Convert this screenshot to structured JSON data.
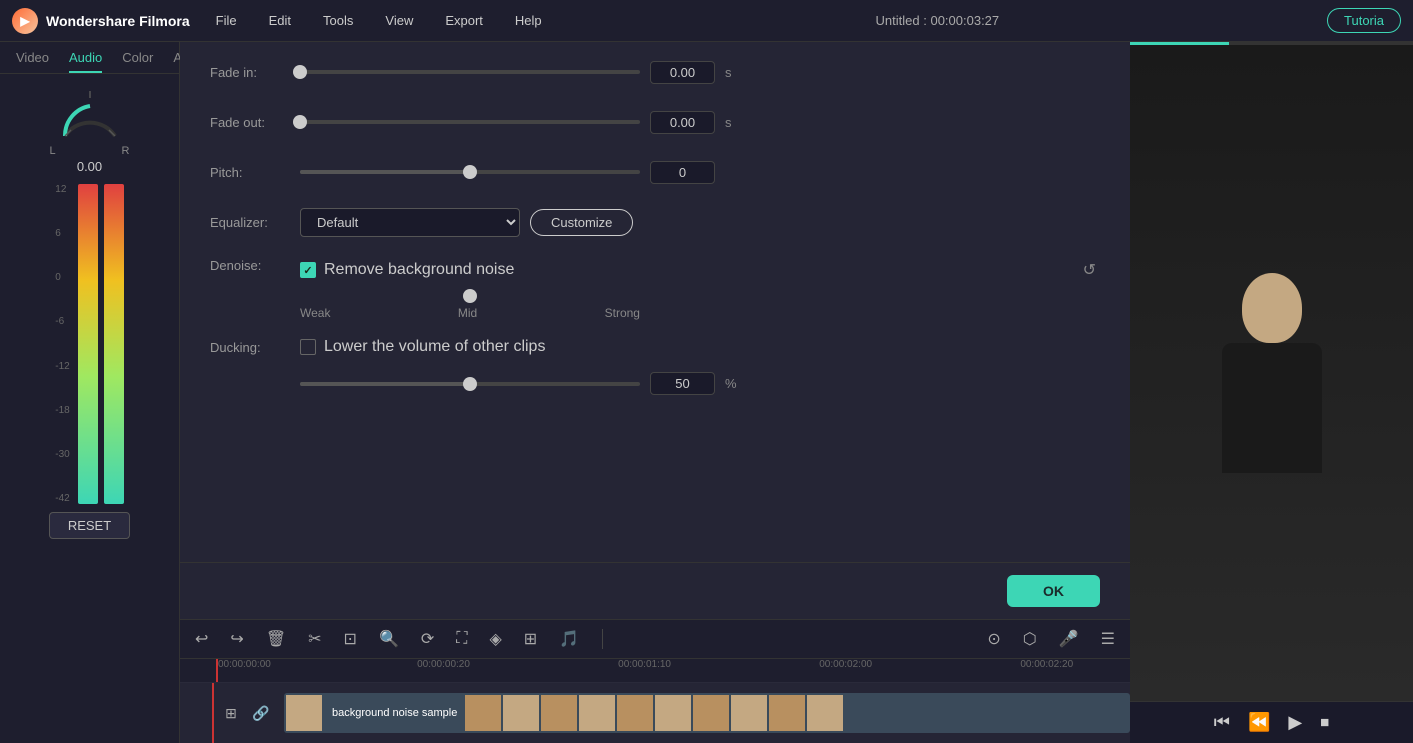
{
  "app": {
    "name": "Wondershare Filmora",
    "title": "Untitled : 00:00:03:27",
    "tutorial_label": "Tutoria"
  },
  "menu": {
    "items": [
      "File",
      "Edit",
      "Tools",
      "View",
      "Export",
      "Help"
    ]
  },
  "tabs": {
    "items": [
      "Video",
      "Audio",
      "Color",
      "Animation"
    ],
    "active": "Audio"
  },
  "audio_panel": {
    "fade_in_label": "Fade in:",
    "fade_in_value": "0.00",
    "fade_in_unit": "s",
    "fade_out_label": "Fade out:",
    "fade_out_value": "0.00",
    "fade_out_unit": "s",
    "pitch_label": "Pitch:",
    "pitch_value": "0",
    "equalizer_label": "Equalizer:",
    "equalizer_default": "Default",
    "customize_label": "Customize",
    "denoise_label": "Denoise:",
    "denoise_checkbox_label": "Remove background noise",
    "denoise_weak": "Weak",
    "denoise_mid": "Mid",
    "denoise_strong": "Strong",
    "ducking_label": "Ducking:",
    "ducking_checkbox_label": "Lower the volume of other clips",
    "ducking_value": "50",
    "ducking_unit": "%"
  },
  "volume": {
    "value": "0.00",
    "left_label": "L",
    "right_label": "R"
  },
  "meter_scale": [
    "12",
    "6",
    "0",
    "-6",
    "-12",
    "-18",
    "-30",
    "-42"
  ],
  "buttons": {
    "reset": "RESET",
    "ok": "OK"
  },
  "timeline": {
    "timestamps": [
      "00:00:00:00",
      "00:00:00:20",
      "00:00:01:10",
      "00:00:02:00",
      "00:00:02:20"
    ],
    "track_label": "background noise sample"
  },
  "slider_positions": {
    "fade_in": 0,
    "fade_out": 0,
    "pitch": 50,
    "denoise": 50,
    "ducking": 50
  }
}
